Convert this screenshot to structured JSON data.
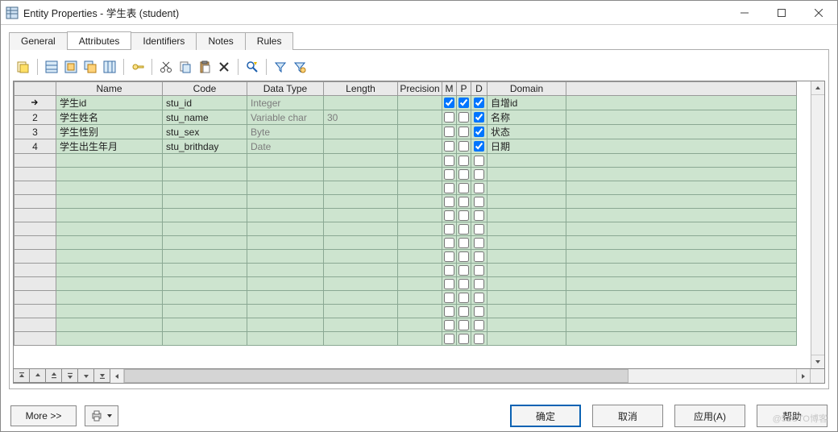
{
  "window": {
    "title": "Entity Properties - 学生表 (student)"
  },
  "tabs": [
    "General",
    "Attributes",
    "Identifiers",
    "Notes",
    "Rules"
  ],
  "active_tab_index": 1,
  "columns": [
    "Name",
    "Code",
    "Data Type",
    "Length",
    "Precision",
    "M",
    "P",
    "D",
    "Domain"
  ],
  "rows": [
    {
      "num": "",
      "arrow": true,
      "name": "学生id",
      "code": "stu_id",
      "dtype": "Integer",
      "length": "",
      "precision": "",
      "m": true,
      "p": true,
      "d": true,
      "domain": "自增id"
    },
    {
      "num": "2",
      "name": "学生姓名",
      "code": "stu_name",
      "dtype": "Variable char",
      "length": "30",
      "precision": "",
      "m": false,
      "p": false,
      "d": true,
      "domain": "名称"
    },
    {
      "num": "3",
      "name": "学生性别",
      "code": "stu_sex",
      "dtype": "Byte",
      "length": "",
      "precision": "",
      "m": false,
      "p": false,
      "d": true,
      "domain": "状态"
    },
    {
      "num": "4",
      "name": "学生出生年月",
      "code": "stu_brithday",
      "dtype": "Date",
      "length": "",
      "precision": "",
      "m": false,
      "p": false,
      "d": true,
      "domain": "日期"
    }
  ],
  "empty_rows": 14,
  "buttons": {
    "more": "More >>",
    "ok": "确定",
    "cancel": "取消",
    "apply": "应用(A)",
    "help": "帮助"
  },
  "watermark": "@51CTO博客"
}
